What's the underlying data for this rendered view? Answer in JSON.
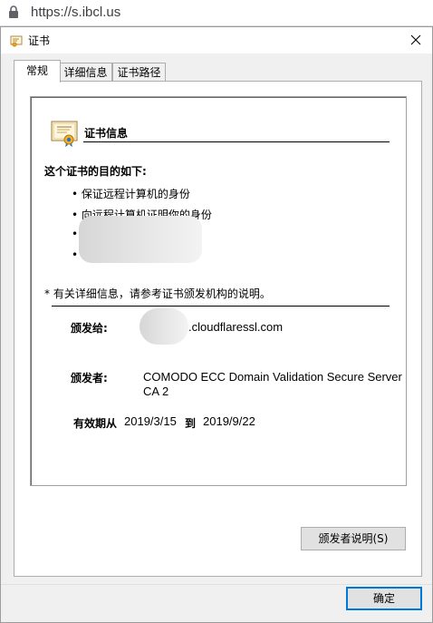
{
  "browser": {
    "url": "https://s.ibcl.us"
  },
  "dialog": {
    "title": "证书",
    "tabs": [
      "常规",
      "详细信息",
      "证书路径"
    ],
    "heading": "证书信息",
    "purpose_title": "这个证书的目的如下:",
    "purposes": [
      "保证远程计算机的身份",
      "向远程计算机证明你的身份"
    ],
    "note": "* 有关详细信息，请参考证书颁发机构的说明。",
    "issued_to_label": "颁发给:",
    "issued_to_value": ".cloudflaressl.com",
    "issued_by_label": "颁发者:",
    "issued_by_value_line1": "COMODO ECC Domain Validation Secure Server",
    "issued_by_value_line2": "CA 2",
    "validity_label": "有效期从",
    "valid_from": "2019/3/15",
    "to_label": "到",
    "valid_to": "2019/9/22",
    "issuer_statement_button": "颁发者说明(S)",
    "ok_button": "确定"
  }
}
